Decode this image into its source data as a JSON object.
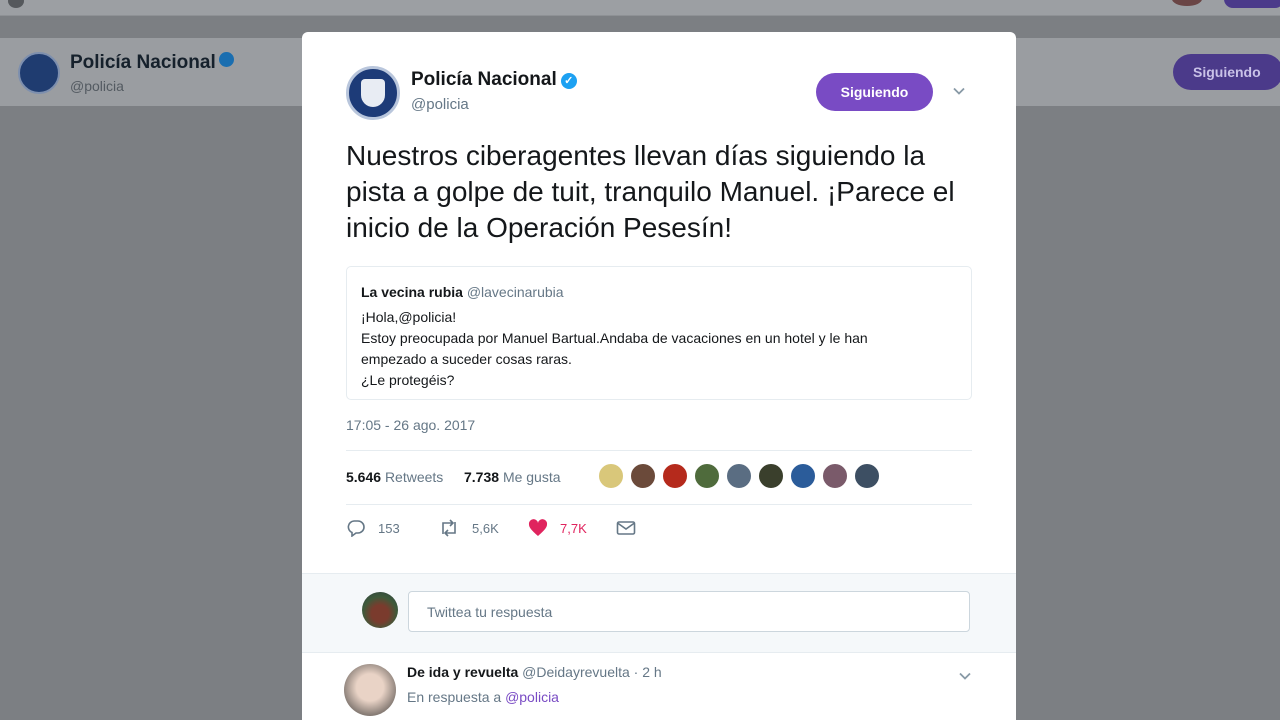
{
  "background_profile": {
    "name": "Policía Nacional",
    "handle": "@policia",
    "follow_label": "Siguiendo"
  },
  "tweet": {
    "author_name": "Policía Nacional",
    "author_handle": "@policia",
    "follow_label": "Siguiendo",
    "text": "Nuestros ciberagentes llevan días siguiendo la pista a golpe de tuit, tranquilo Manuel. ¡Parece el inicio de la Operación Pesesín!",
    "quote": {
      "name": "La vecina rubia",
      "handle": "@lavecinarubia",
      "lines": [
        "¡Hola,@policia!",
        "Estoy preocupada por Manuel Bartual.Andaba de vacaciones en un hotel y le han",
        "empezado a suceder cosas raras.",
        "¿Le protegéis?"
      ]
    },
    "timestamp": "17:05 - 26 ago. 2017",
    "stats": {
      "retweets_count": "5.646",
      "retweets_label": "Retweets",
      "likes_count": "7.738",
      "likes_label": "Me gusta"
    },
    "liker_colors": [
      "#d9c77a",
      "#6b4a3a",
      "#b52a1c",
      "#4f6b3c",
      "#5a6d82",
      "#3a3f2c",
      "#2b5c9a",
      "#7a5a6a",
      "#3d4f63"
    ],
    "actions": {
      "replies": "153",
      "retweets": "5,6K",
      "likes": "7,7K"
    },
    "accent_color": "#794bc4",
    "like_color": "#e0245e"
  },
  "reply_box": {
    "placeholder": "Twittea tu respuesta"
  },
  "reply": {
    "name": "De ida y revuelta",
    "handle": "@Deidayrevuelta",
    "time": "2 h",
    "reply_to_prefix": "En respuesta a",
    "reply_to_mention": "@policia"
  }
}
